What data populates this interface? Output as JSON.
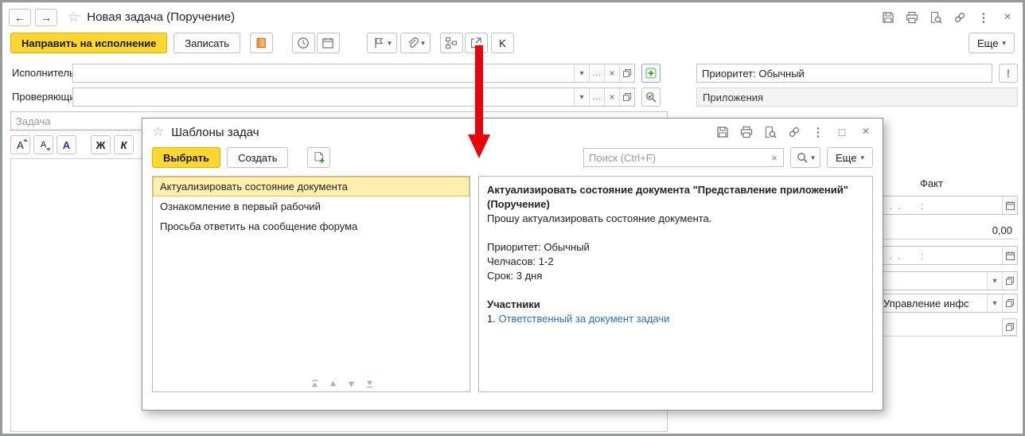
{
  "glyphs": {
    "back": "←",
    "forward": "→",
    "star": "☆",
    "kebab": "⋮",
    "close": "×",
    "maximize": "□",
    "dropdown": "▾",
    "ellipsis": "...",
    "clear": "×",
    "exclamation": "!",
    "bold": "Ж",
    "italic": "К",
    "font_letter": "А"
  },
  "window": {
    "title": "Новая задача (Поручение)",
    "toolbar": {
      "send": "Направить на исполнение",
      "save": "Записать",
      "k": "K",
      "more": "Еще"
    },
    "form": {
      "executor_label": "Исполнитель:",
      "reviewer_label": "Проверяющий:",
      "task_placeholder": "Задача",
      "priority_value": "Приоритет: Обычный",
      "attachments_title": "Приложения",
      "fact_label": "Факт",
      "date_placeholder": "  .  .       :",
      "amount_value": "0,00",
      "department_value": "Управление инфс"
    }
  },
  "dialog": {
    "title": "Шаблоны задач",
    "select": "Выбрать",
    "create": "Создать",
    "search_placeholder": "Поиск (Ctrl+F)",
    "more": "Еще",
    "items": [
      "Актуализировать состояние документа",
      "Ознакомление в первый рабочий",
      "Просьба ответить на сообщение форума"
    ],
    "detail": {
      "heading": "Актуализировать состояние документа \"Представление приложений\" (Поручение)",
      "request": "Прошу актуализировать состояние документа.",
      "priority": "Приоритет: Обычный",
      "hours": "Челчасов: 1-2",
      "term": "Срок: 3 дня",
      "participants_title": "Участники",
      "participant_index": "1.",
      "participant_link": "Ответственный за документ задачи"
    }
  },
  "colors": {
    "accent_yellow": "#ffd632",
    "selection_yellow": "#ffefae",
    "link_blue": "#3070b8",
    "arrow_red": "#e8000b"
  }
}
